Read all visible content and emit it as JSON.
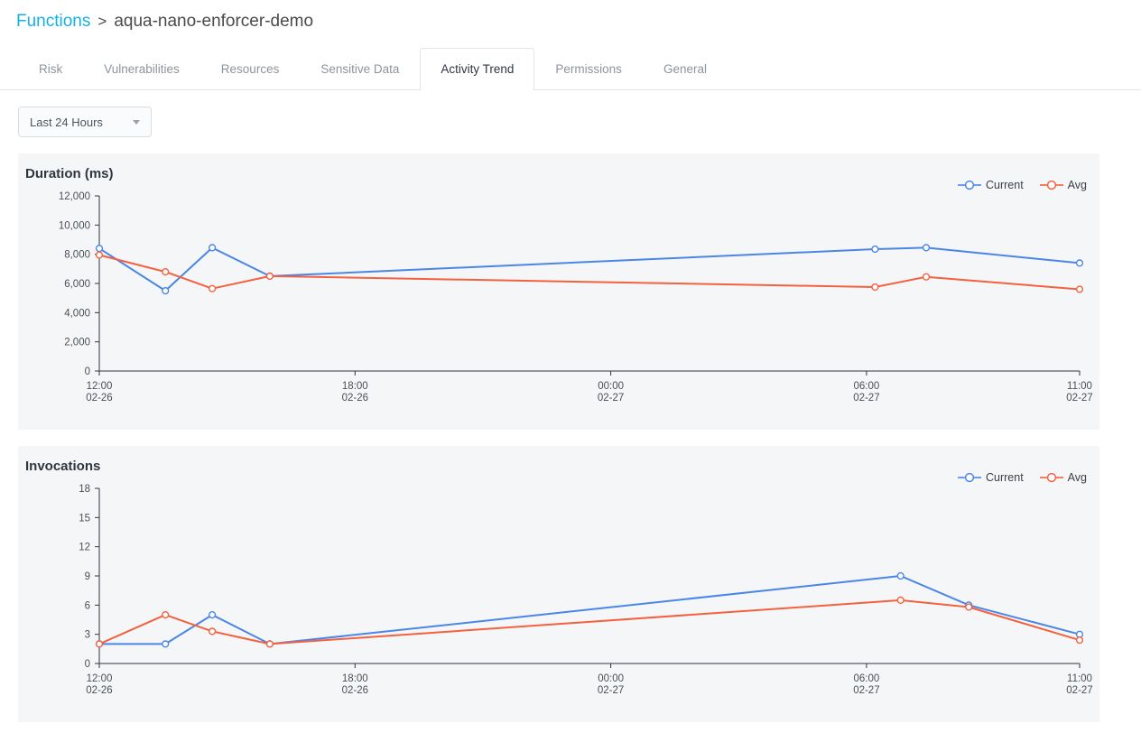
{
  "breadcrumb": {
    "root": "Functions",
    "separator": ">",
    "current": "aqua-nano-enforcer-demo"
  },
  "tabs": [
    {
      "label": "Risk",
      "active": false
    },
    {
      "label": "Vulnerabilities",
      "active": false
    },
    {
      "label": "Resources",
      "active": false
    },
    {
      "label": "Sensitive Data",
      "active": false
    },
    {
      "label": "Activity Trend",
      "active": true
    },
    {
      "label": "Permissions",
      "active": false
    },
    {
      "label": "General",
      "active": false
    }
  ],
  "toolbar": {
    "range_value": "Last 24 Hours",
    "caret_icon": "chevron-down-icon"
  },
  "colors": {
    "current": "#4a86e8",
    "avg": "#f4613f",
    "link": "#14b2e2",
    "card_bg": "#f5f6f8",
    "axis": "#4a4f57"
  },
  "chart_data": [
    {
      "type": "line",
      "title": "Duration (ms)",
      "xlabel": "",
      "ylabel": "",
      "ylim": [
        0,
        12000
      ],
      "yticks": [
        0,
        2000,
        4000,
        6000,
        8000,
        10000,
        12000
      ],
      "ytick_labels": [
        "0",
        "2,000",
        "4,000",
        "6,000",
        "8,000",
        "10,000",
        "12,000"
      ],
      "grid": false,
      "legend": [
        "Current",
        "Avg"
      ],
      "legend_position": "top-right",
      "xlim": [
        0,
        23
      ],
      "xticks": [
        0,
        6,
        12,
        18,
        23
      ],
      "xtick_labels": [
        {
          "time": "12:00",
          "date": "02-26"
        },
        {
          "time": "18:00",
          "date": "02-26"
        },
        {
          "time": "00:00",
          "date": "02-27"
        },
        {
          "time": "06:00",
          "date": "02-27"
        },
        {
          "time": "11:00",
          "date": "02-27"
        }
      ],
      "x": [
        0,
        1.55,
        2.65,
        4.0,
        18.2,
        19.4,
        20.2,
        23
      ],
      "series": [
        {
          "name": "Current",
          "color": "#4a86e8",
          "values": [
            8400,
            5500,
            8450,
            6500,
            8350,
            8450,
            null,
            7400
          ]
        },
        {
          "name": "Avg",
          "color": "#f4613f",
          "values": [
            7950,
            6800,
            5650,
            6500,
            5750,
            6450,
            null,
            5600
          ]
        }
      ]
    },
    {
      "type": "line",
      "title": "Invocations",
      "xlabel": "",
      "ylabel": "",
      "ylim": [
        0,
        18
      ],
      "yticks": [
        0,
        3,
        6,
        9,
        12,
        15,
        18
      ],
      "ytick_labels": [
        "0",
        "3",
        "6",
        "9",
        "12",
        "15",
        "18"
      ],
      "grid": false,
      "legend": [
        "Current",
        "Avg"
      ],
      "legend_position": "top-right",
      "xlim": [
        0,
        23
      ],
      "xticks": [
        0,
        6,
        12,
        18,
        23
      ],
      "xtick_labels": [
        {
          "time": "12:00",
          "date": "02-26"
        },
        {
          "time": "18:00",
          "date": "02-26"
        },
        {
          "time": "00:00",
          "date": "02-27"
        },
        {
          "time": "06:00",
          "date": "02-27"
        },
        {
          "time": "11:00",
          "date": "02-27"
        }
      ],
      "x": [
        0,
        1.55,
        2.65,
        4.0,
        18.8,
        20.4,
        23
      ],
      "series": [
        {
          "name": "Current",
          "color": "#4a86e8",
          "values": [
            2,
            2,
            5,
            2,
            9,
            6,
            3
          ]
        },
        {
          "name": "Avg",
          "color": "#f4613f",
          "values": [
            2,
            5,
            3.3,
            2,
            6.5,
            5.8,
            2.4
          ]
        }
      ]
    }
  ]
}
